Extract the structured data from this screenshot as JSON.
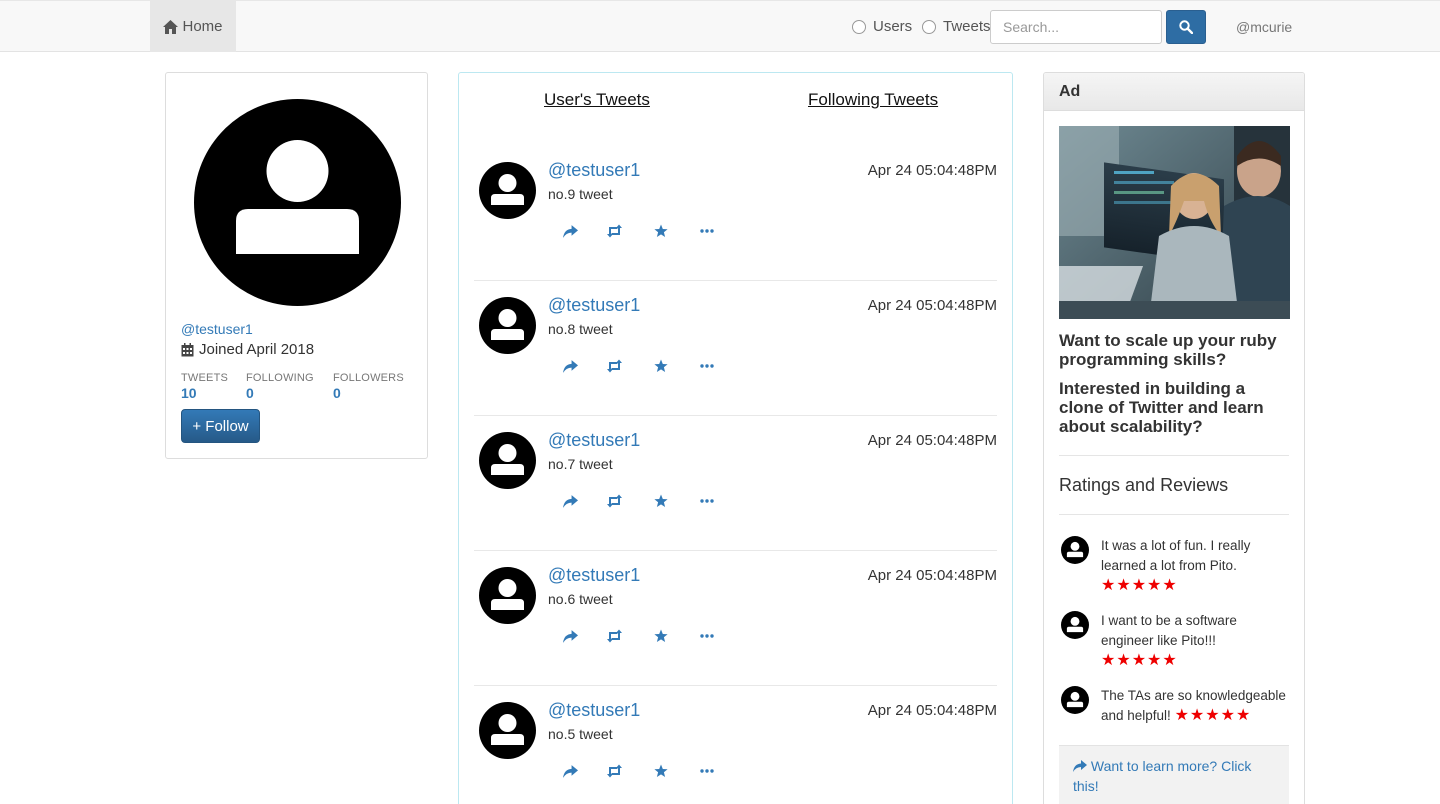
{
  "navbar": {
    "home_label": "Home",
    "radio_users_label": "Users",
    "radio_tweets_label": "Tweets",
    "search_placeholder": "Search...",
    "username": "@mcurie"
  },
  "profile": {
    "handle": "@testuser1",
    "joined": "Joined April 2018",
    "stats": [
      {
        "label": "TWEETS",
        "value": "10"
      },
      {
        "label": "FOLLOWING",
        "value": "0"
      },
      {
        "label": "FOLLOWERS",
        "value": "0"
      }
    ],
    "follow_label": "+ Follow"
  },
  "feed": {
    "tabs": [
      "User's Tweets",
      "Following Tweets"
    ],
    "tweets": [
      {
        "user": "@testuser1",
        "time": "Apr 24 05:04:48PM",
        "text": "no.9 tweet"
      },
      {
        "user": "@testuser1",
        "time": "Apr 24 05:04:48PM",
        "text": "no.8 tweet"
      },
      {
        "user": "@testuser1",
        "time": "Apr 24 05:04:48PM",
        "text": "no.7 tweet"
      },
      {
        "user": "@testuser1",
        "time": "Apr 24 05:04:48PM",
        "text": "no.6 tweet"
      },
      {
        "user": "@testuser1",
        "time": "Apr 24 05:04:48PM",
        "text": "no.5 tweet"
      }
    ],
    "actions": [
      "reply-icon",
      "retweet-icon",
      "star-icon",
      "more-icon"
    ]
  },
  "ad": {
    "heading": "Ad",
    "headline1": "Want to scale up your ruby programming skills?",
    "headline2": "Interested in building a clone of Twitter and learn about scalability?",
    "ratings_title": "Ratings and Reviews",
    "reviews": [
      {
        "text": "It was a lot of fun. I really learned a lot from Pito.",
        "stars": 5
      },
      {
        "text": "I want to be a software engineer like Pito!!!",
        "stars": 5
      },
      {
        "text": "The TAs are so knowledgeable and helpful!",
        "stars": 5
      }
    ],
    "cta": "Want to learn more? Click this!"
  },
  "colors": {
    "link_blue": "#337ab7",
    "button_blue": "#2e6da4",
    "star_red": "#ee0000"
  }
}
